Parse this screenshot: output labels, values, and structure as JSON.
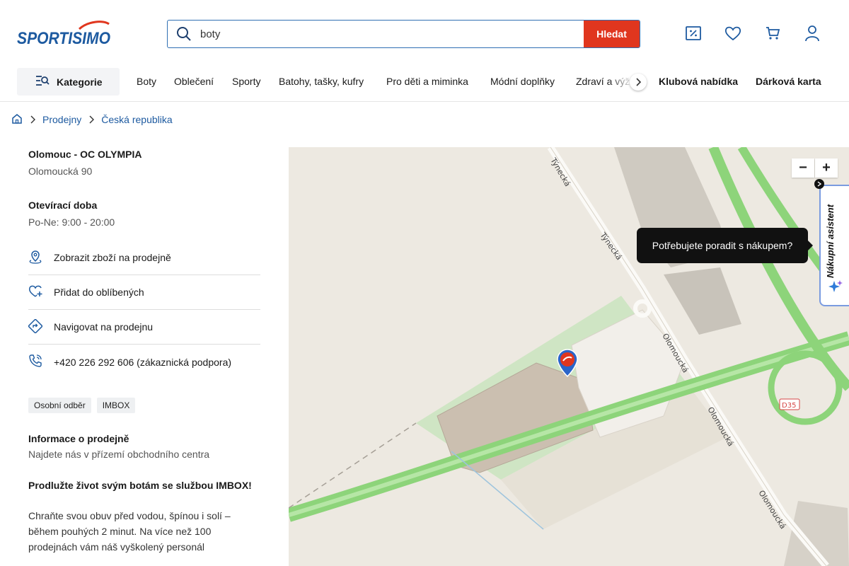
{
  "brand": {
    "logo_text": "SPORTISIMO",
    "red": "#e0361e",
    "blue": "#1d5aa0"
  },
  "search": {
    "value": "boty",
    "button_label": "Hledat"
  },
  "header_icons": [
    "discount-icon",
    "heart-icon",
    "cart-icon",
    "user-icon"
  ],
  "nav": {
    "category_label": "Kategorie",
    "items": [
      "Boty",
      "Oblečení",
      "Sporty",
      "Batohy, tašky, kufry",
      "Pro děti a miminka",
      "Módní doplňky",
      "Zdraví a výž"
    ],
    "bold_items": [
      "Klubová nabídka",
      "Dárková karta"
    ]
  },
  "breadcrumb": [
    "Prodejny",
    "Česká republika"
  ],
  "store": {
    "name": "Olomouc - OC OLYMPIA",
    "address": "Olomoucká 90",
    "hours_title": "Otevírací doba",
    "hours": "Po-Ne: 9:00 - 20:00",
    "actions": [
      "Zobrazit zboží na prodejně",
      "Přidat do oblíbených",
      "Navigovat na prodejnu",
      "+420 226 292 606 (zákaznická podpora)"
    ],
    "tags": [
      "Osobní odběr",
      "IMBOX"
    ],
    "info_title": "Informace o prodejně",
    "info_text": "Najdete nás v přízemí obchodního centra",
    "promo_title": "Prodlužte život svým botám se službou IMBOX!",
    "promo_text": "Chraňte svou obuv před vodou, špínou i solí – během pouhých 2 minut. Na více než 100 prodejnách vám náš vyškolený personál"
  },
  "map": {
    "street_labels": [
      "Týnecká",
      "Týnecká",
      "Olomoucká",
      "Olomoucká",
      "Olomoucká"
    ],
    "road_badge": "D35",
    "zoom_out": "−",
    "zoom_in": "+"
  },
  "assistant": {
    "tooltip": "Potřebujete poradit s nákupem?",
    "label": "Nákupní asistent"
  }
}
